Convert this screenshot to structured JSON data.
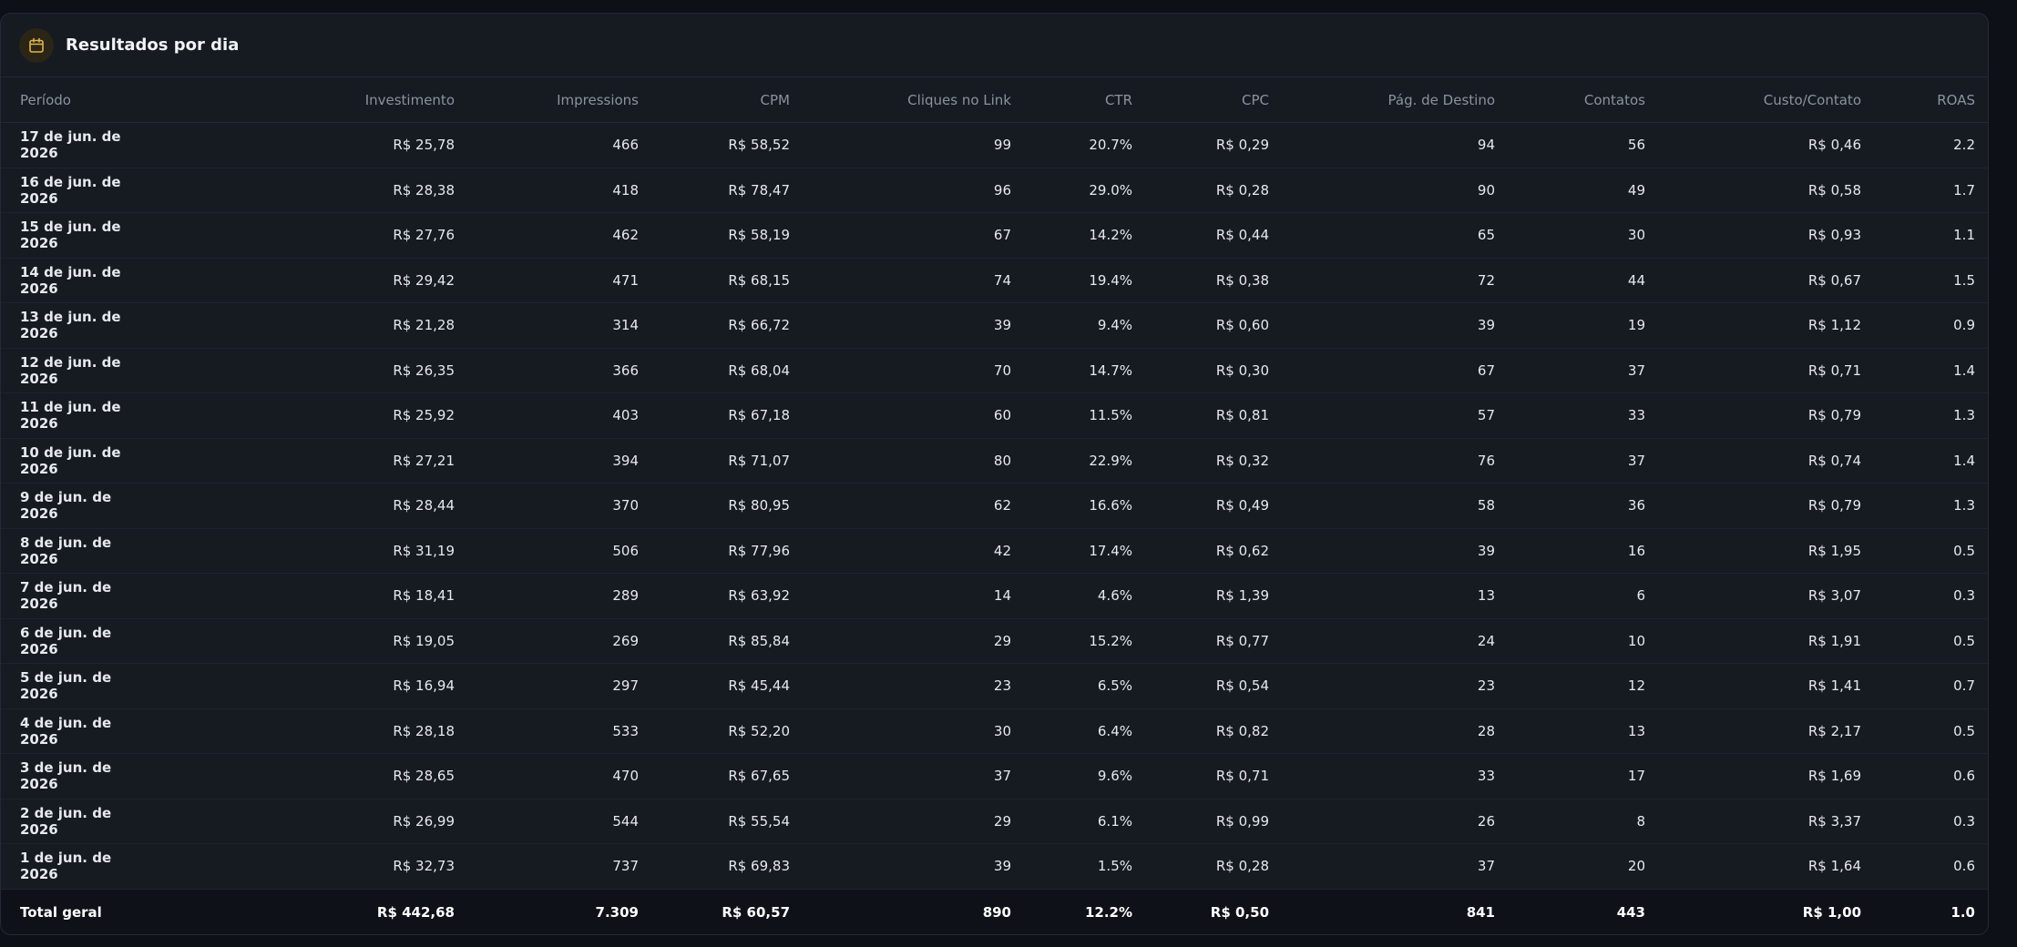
{
  "header": {
    "title": "Resultados por dia",
    "icon": "calendar-icon",
    "accent_color": "#e0b44c"
  },
  "columns": [
    "Período",
    "Investimento",
    "Impressions",
    "CPM",
    "Cliques no Link",
    "CTR",
    "CPC",
    "Pág. de Destino",
    "Contatos",
    "Custo/Contato",
    "ROAS"
  ],
  "rows": [
    [
      "17 de jun. de 2026",
      "R$ 25,78",
      "466",
      "R$ 58,52",
      "99",
      "20.7%",
      "R$ 0,29",
      "94",
      "56",
      "R$ 0,46",
      "2.2"
    ],
    [
      "16 de jun. de 2026",
      "R$ 28,38",
      "418",
      "R$ 78,47",
      "96",
      "29.0%",
      "R$ 0,28",
      "90",
      "49",
      "R$ 0,58",
      "1.7"
    ],
    [
      "15 de jun. de 2026",
      "R$ 27,76",
      "462",
      "R$ 58,19",
      "67",
      "14.2%",
      "R$ 0,44",
      "65",
      "30",
      "R$ 0,93",
      "1.1"
    ],
    [
      "14 de jun. de 2026",
      "R$ 29,42",
      "471",
      "R$ 68,15",
      "74",
      "19.4%",
      "R$ 0,38",
      "72",
      "44",
      "R$ 0,67",
      "1.5"
    ],
    [
      "13 de jun. de 2026",
      "R$ 21,28",
      "314",
      "R$ 66,72",
      "39",
      "9.4%",
      "R$ 0,60",
      "39",
      "19",
      "R$ 1,12",
      "0.9"
    ],
    [
      "12 de jun. de 2026",
      "R$ 26,35",
      "366",
      "R$ 68,04",
      "70",
      "14.7%",
      "R$ 0,30",
      "67",
      "37",
      "R$ 0,71",
      "1.4"
    ],
    [
      "11 de jun. de 2026",
      "R$ 25,92",
      "403",
      "R$ 67,18",
      "60",
      "11.5%",
      "R$ 0,81",
      "57",
      "33",
      "R$ 0,79",
      "1.3"
    ],
    [
      "10 de jun. de 2026",
      "R$ 27,21",
      "394",
      "R$ 71,07",
      "80",
      "22.9%",
      "R$ 0,32",
      "76",
      "37",
      "R$ 0,74",
      "1.4"
    ],
    [
      "9 de jun. de 2026",
      "R$ 28,44",
      "370",
      "R$ 80,95",
      "62",
      "16.6%",
      "R$ 0,49",
      "58",
      "36",
      "R$ 0,79",
      "1.3"
    ],
    [
      "8 de jun. de 2026",
      "R$ 31,19",
      "506",
      "R$ 77,96",
      "42",
      "17.4%",
      "R$ 0,62",
      "39",
      "16",
      "R$ 1,95",
      "0.5"
    ],
    [
      "7 de jun. de 2026",
      "R$ 18,41",
      "289",
      "R$ 63,92",
      "14",
      "4.6%",
      "R$ 1,39",
      "13",
      "6",
      "R$ 3,07",
      "0.3"
    ],
    [
      "6 de jun. de 2026",
      "R$ 19,05",
      "269",
      "R$ 85,84",
      "29",
      "15.2%",
      "R$ 0,77",
      "24",
      "10",
      "R$ 1,91",
      "0.5"
    ],
    [
      "5 de jun. de 2026",
      "R$ 16,94",
      "297",
      "R$ 45,44",
      "23",
      "6.5%",
      "R$ 0,54",
      "23",
      "12",
      "R$ 1,41",
      "0.7"
    ],
    [
      "4 de jun. de 2026",
      "R$ 28,18",
      "533",
      "R$ 52,20",
      "30",
      "6.4%",
      "R$ 0,82",
      "28",
      "13",
      "R$ 2,17",
      "0.5"
    ],
    [
      "3 de jun. de 2026",
      "R$ 28,65",
      "470",
      "R$ 67,65",
      "37",
      "9.6%",
      "R$ 0,71",
      "33",
      "17",
      "R$ 1,69",
      "0.6"
    ],
    [
      "2 de jun. de 2026",
      "R$ 26,99",
      "544",
      "R$ 55,54",
      "29",
      "6.1%",
      "R$ 0,99",
      "26",
      "8",
      "R$ 3,37",
      "0.3"
    ],
    [
      "1 de jun. de 2026",
      "R$ 32,73",
      "737",
      "R$ 69,83",
      "39",
      "1.5%",
      "R$ 0,28",
      "37",
      "20",
      "R$ 1,64",
      "0.6"
    ]
  ],
  "total": [
    "Total geral",
    "R$ 442,68",
    "7.309",
    "R$ 60,57",
    "890",
    "12.2%",
    "R$ 0,50",
    "841",
    "443",
    "R$ 1,00",
    "1.0"
  ]
}
